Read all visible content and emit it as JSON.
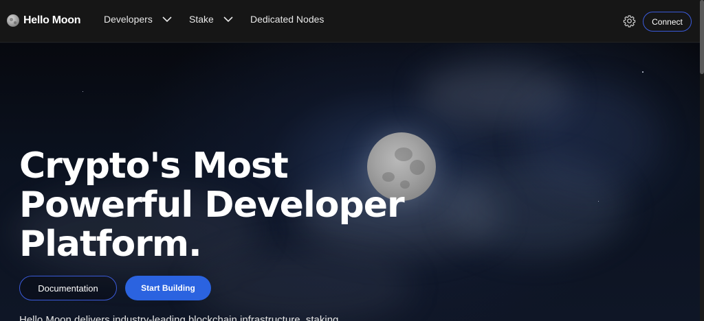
{
  "nav": {
    "brand": "Hello Moon",
    "items": [
      {
        "label": "Developers",
        "has_dropdown": true
      },
      {
        "label": "Stake",
        "has_dropdown": true
      },
      {
        "label": "Dedicated Nodes",
        "has_dropdown": false
      }
    ],
    "settings_icon": "gear-icon",
    "connect_label": "Connect"
  },
  "hero": {
    "headline_lines": [
      "Crypto's Most",
      "Powerful Developer",
      "Platform."
    ],
    "documentation_label": "Documentation",
    "start_building_label": "Start Building",
    "description": "Hello Moon delivers industry-leading blockchain infrastructure, staking"
  },
  "colors": {
    "accent_blue": "#2b63e0",
    "outline_blue": "#3b5bdb",
    "nav_bg": "#161616"
  }
}
